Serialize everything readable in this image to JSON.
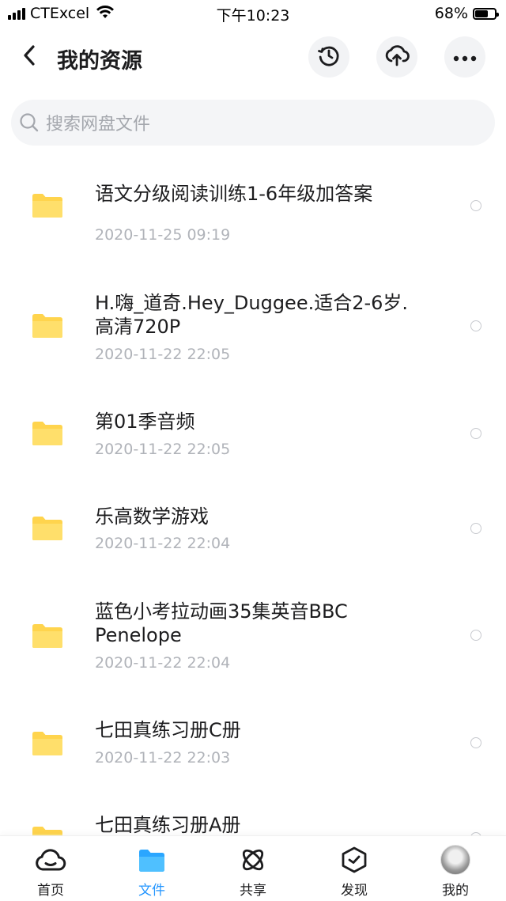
{
  "status_bar": {
    "carrier": "CTExcel",
    "time": "下午10:23",
    "battery": "68%",
    "battery_level": 0.68
  },
  "header": {
    "title": "我的资源",
    "back_icon": "chevron-left-icon",
    "actions": [
      "history-icon",
      "cloud-upload-icon",
      "more-icon"
    ]
  },
  "search": {
    "placeholder": "搜索网盘文件"
  },
  "files": [
    {
      "name": "语文分级阅读训练1-6年级加答案",
      "date": "2020-11-25 09:19"
    },
    {
      "name": "H.嗨_道奇.Hey_Duggee.适合2-6岁.高清720P",
      "date": "2020-11-22 22:05"
    },
    {
      "name": "第01季音频",
      "date": "2020-11-22 22:05"
    },
    {
      "name": "乐高数学游戏",
      "date": "2020-11-22 22:04"
    },
    {
      "name": "蓝色小考拉动画35集英音BBC Penelope",
      "date": "2020-11-22 22:04"
    },
    {
      "name": "七田真练习册C册",
      "date": "2020-11-22 22:03"
    },
    {
      "name": "七田真练习册A册",
      "date": ""
    }
  ],
  "tabbar": {
    "items": [
      {
        "label": "首页",
        "icon": "cloud-home-icon"
      },
      {
        "label": "文件",
        "icon": "folder-icon"
      },
      {
        "label": "共享",
        "icon": "atom-share-icon"
      },
      {
        "label": "发现",
        "icon": "discover-box-icon"
      },
      {
        "label": "我的",
        "icon": "avatar"
      }
    ],
    "active_index": 1
  },
  "colors": {
    "accent": "#2496ff",
    "folder": "#ffd44d",
    "text": "#1c1c1e",
    "secondary": "#b0b3b9"
  }
}
